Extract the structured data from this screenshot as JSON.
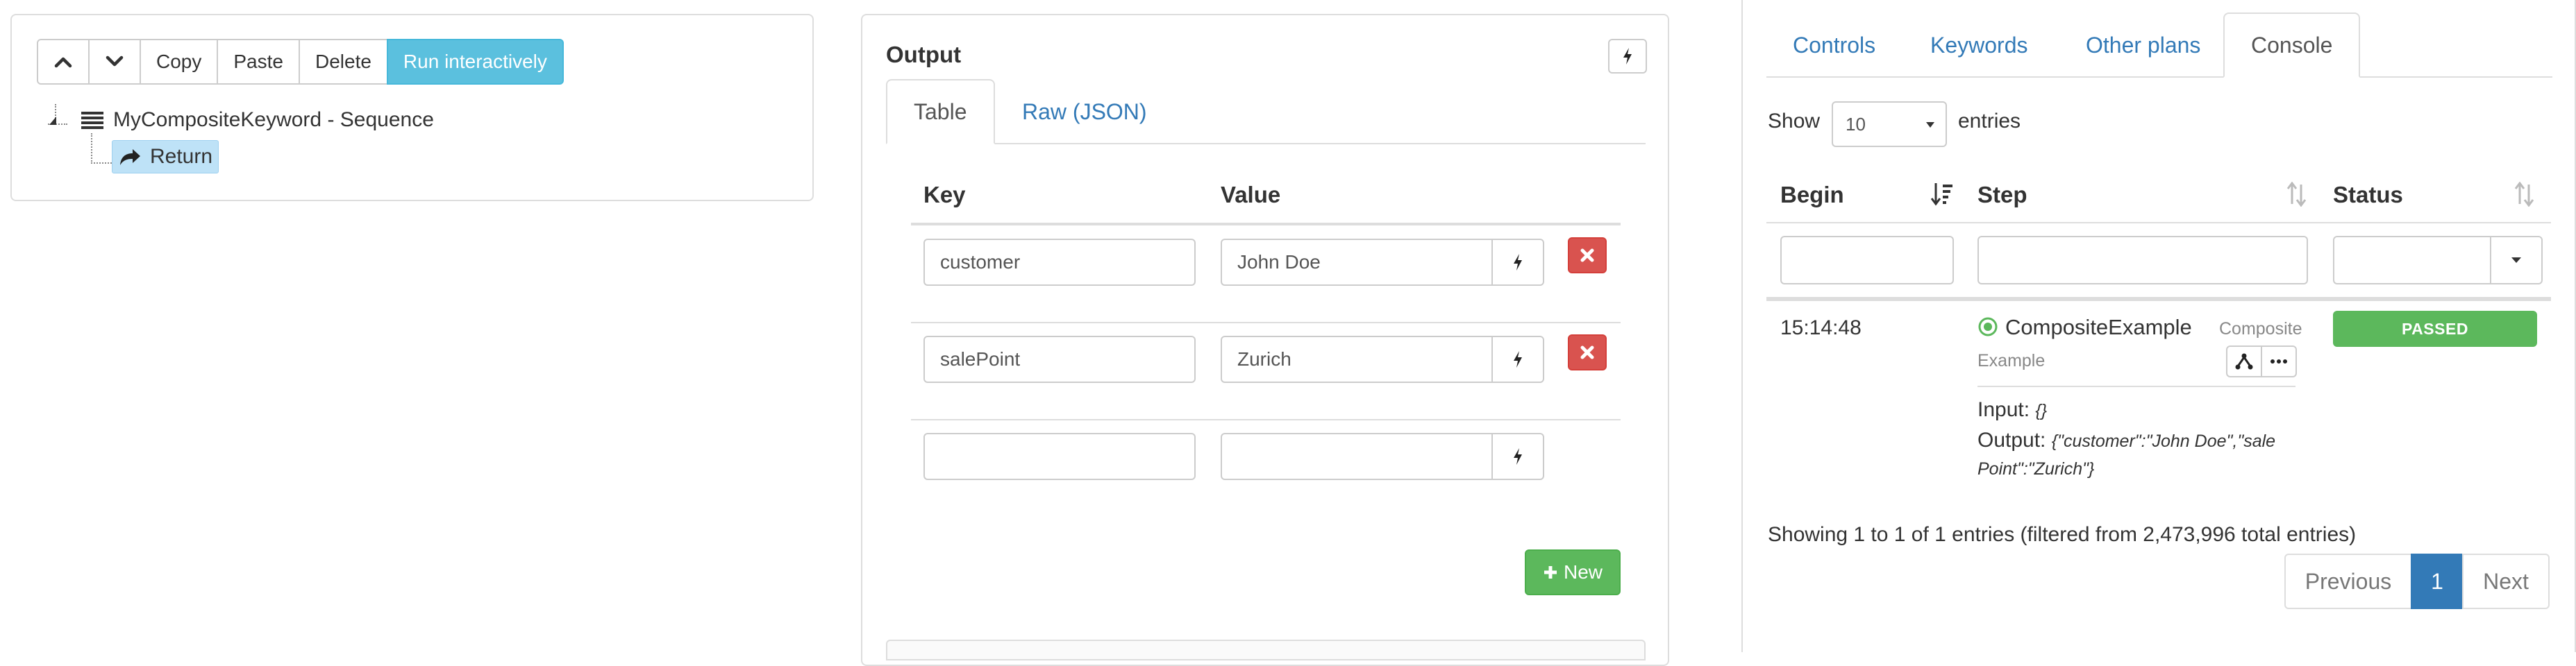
{
  "left": {
    "toolbar": {
      "up_icon": "chevron-up-icon",
      "down_icon": "chevron-down-icon",
      "copy_label": "Copy",
      "paste_label": "Paste",
      "delete_label": "Delete",
      "run_label": "Run interactively"
    },
    "tree": {
      "root_label": "MyCompositeKeyword - Sequence",
      "root_icon": "list-icon",
      "child_label": "Return",
      "child_icon": "share-arrow-icon"
    }
  },
  "output": {
    "title": "Output",
    "tabs": [
      "Table",
      "Raw (JSON)"
    ],
    "active_tab": "Table",
    "headers": {
      "key": "Key",
      "value": "Value"
    },
    "rows": [
      {
        "key": "customer",
        "value": "John Doe"
      },
      {
        "key": "salePoint",
        "value": "Zurich"
      },
      {
        "key": "",
        "value": ""
      }
    ],
    "new_label": "New"
  },
  "right": {
    "tabs": [
      "Controls",
      "Keywords",
      "Other plans",
      "Console"
    ],
    "active_tab": "Console",
    "show_label": "Show",
    "entries_value": "10",
    "entries_label": "entries",
    "columns": [
      "Begin",
      "Step",
      "Status"
    ],
    "row": {
      "begin": "15:14:48",
      "step_name": "CompositeExample",
      "step_type_1": "Composite",
      "step_type_2": "Example",
      "input_label": "Input:",
      "input_value": "{}",
      "output_label": "Output:",
      "output_value_1": "{\"customer\":\"John Doe\",\"sale",
      "output_value_2": "Point\":\"Zurich\"}",
      "status": "PASSED"
    },
    "info": "Showing 1 to 1 of 1 entries (filtered from 2,473,996 total entries)",
    "pager": {
      "previous": "Previous",
      "current": "1",
      "next": "Next"
    }
  },
  "colors": {
    "primary": "#337ab7",
    "info": "#5bc0de",
    "success": "#5cb85c",
    "danger": "#d9534f",
    "selection": "#bee2f7"
  }
}
